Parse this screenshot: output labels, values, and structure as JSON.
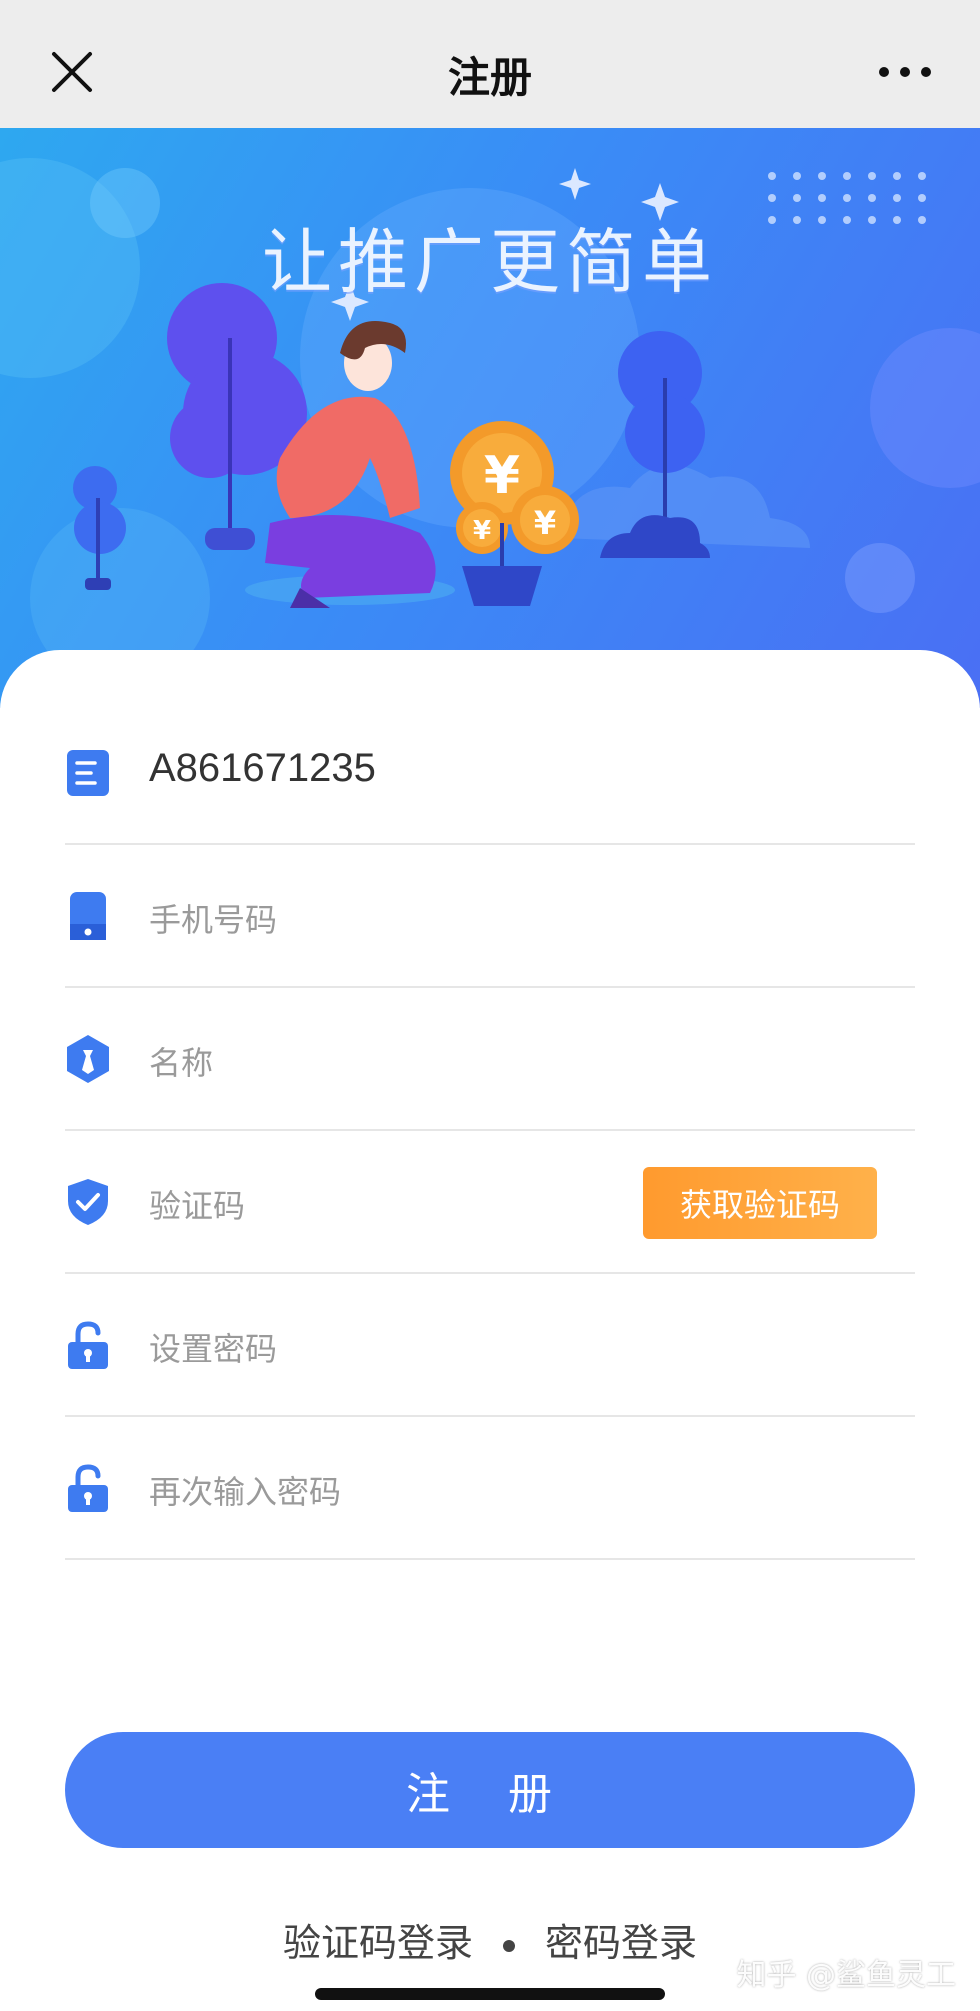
{
  "nav": {
    "title": "注册",
    "close_icon": "close-icon",
    "more_icon": "more-icon"
  },
  "banner": {
    "slogan": "让推广更简单"
  },
  "form": {
    "fields": [
      {
        "icon": "document-icon",
        "value": "A861671235",
        "placeholder": ""
      },
      {
        "icon": "phone-icon",
        "value": "",
        "placeholder": "手机号码"
      },
      {
        "icon": "name-badge-icon",
        "value": "",
        "placeholder": "名称"
      },
      {
        "icon": "shield-check-icon",
        "value": "",
        "placeholder": "验证码"
      },
      {
        "icon": "unlock-icon",
        "value": "",
        "placeholder": "设置密码"
      },
      {
        "icon": "unlock-icon",
        "value": "",
        "placeholder": "再次输入密码"
      }
    ],
    "get_code_label": "获取验证码",
    "register_label": "注 册"
  },
  "login_links": {
    "code_login": "验证码登录",
    "password_login": "密码登录"
  },
  "watermark": "知乎 @鲨鱼灵工",
  "colors": {
    "accent": "#4a7ff5",
    "orange": "#ff9a2e",
    "icon_blue": "#3e7bf0"
  }
}
